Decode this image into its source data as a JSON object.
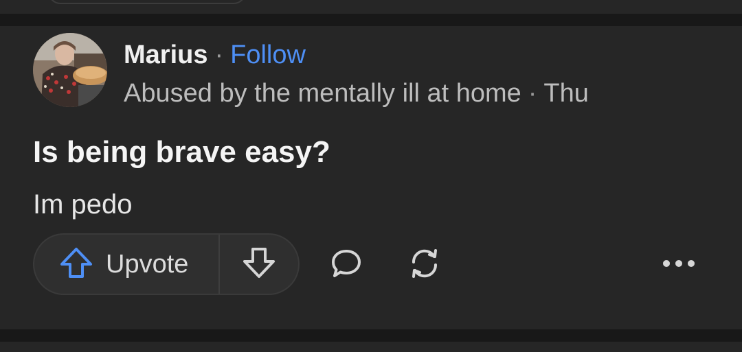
{
  "post": {
    "author": "Marius",
    "separator": "·",
    "follow_label": "Follow",
    "credential": "Abused by the mentally ill at home",
    "timestamp": "Thu",
    "title": "Is being brave easy?",
    "body": "Im pedo"
  },
  "actions": {
    "upvote_label": "Upvote",
    "upvote_icon": "arrow-up-outline-icon",
    "downvote_icon": "arrow-down-outline-icon",
    "comment_icon": "speech-bubble-icon",
    "share_icon": "refresh-arrows-icon",
    "more_icon": "ellipsis-icon"
  },
  "colors": {
    "background": "#181818",
    "card": "#262626",
    "accent": "#4e8ff5",
    "text": "#e6e6e6",
    "muted": "#bdbdbd"
  }
}
